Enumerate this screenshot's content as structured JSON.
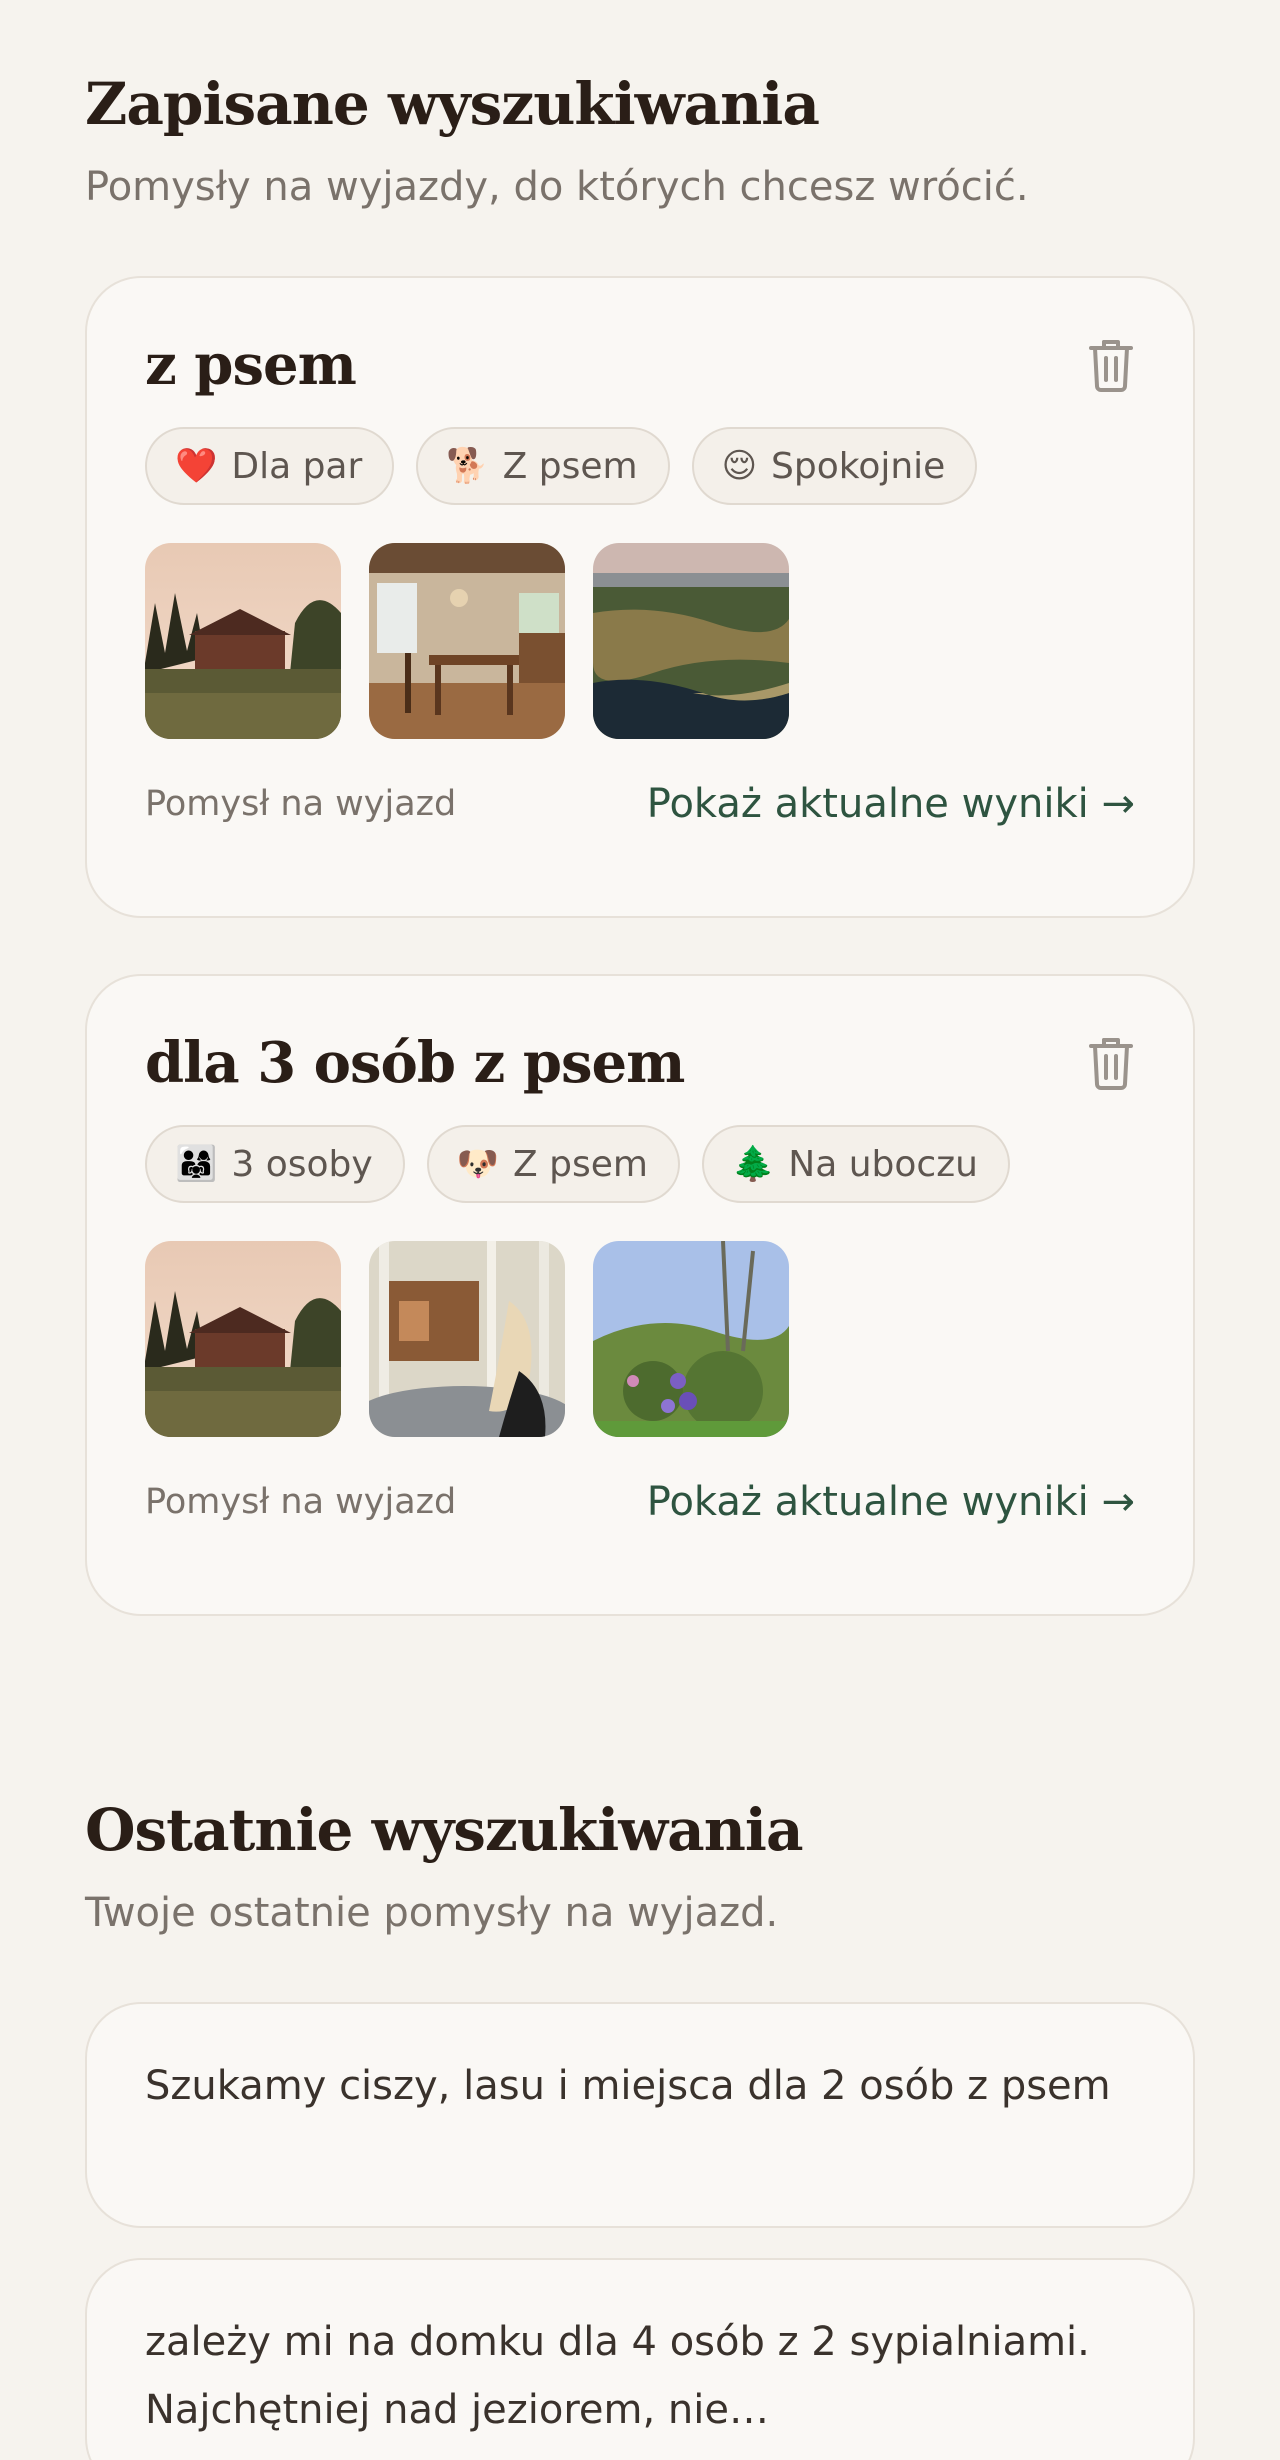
{
  "saved": {
    "title": "Zapisane wyszukiwania",
    "subtitle": "Pomysły na wyjazdy, do których chcesz wrócić.",
    "cards": [
      {
        "title": "z psem",
        "chips": [
          {
            "icon": "❤️",
            "label": "Dla par"
          },
          {
            "icon": "🐕",
            "label": "Z psem"
          },
          {
            "icon": "😌",
            "label": "Spokojnie"
          }
        ],
        "footer_label": "Pomysł na wyjazd",
        "footer_link": "Pokaż aktualne wyniki →"
      },
      {
        "title": "dla 3 osób z psem",
        "chips": [
          {
            "icon": "👨‍👩‍👧",
            "label": "3 osoby"
          },
          {
            "icon": "🐶",
            "label": "Z psem"
          },
          {
            "icon": "🌲",
            "label": "Na uboczu"
          }
        ],
        "footer_label": "Pomysł na wyjazd",
        "footer_link": "Pokaż aktualne wyniki →"
      }
    ]
  },
  "recent": {
    "title": "Ostatnie wyszukiwania",
    "subtitle": "Twoje ostatnie pomysły na wyjazd.",
    "items": [
      {
        "text": "Szukamy ciszy, lasu i miejsca dla 2 osób z psem"
      },
      {
        "text": "zależy mi na domku dla 4 osób z 2 sypialniami. Najchętniej nad jeziorem, nie…"
      }
    ]
  },
  "colors": {
    "background": "#f6f3ee",
    "card": "#faf8f5",
    "accent_link": "#2e5440",
    "muted_text": "#7a726b"
  }
}
